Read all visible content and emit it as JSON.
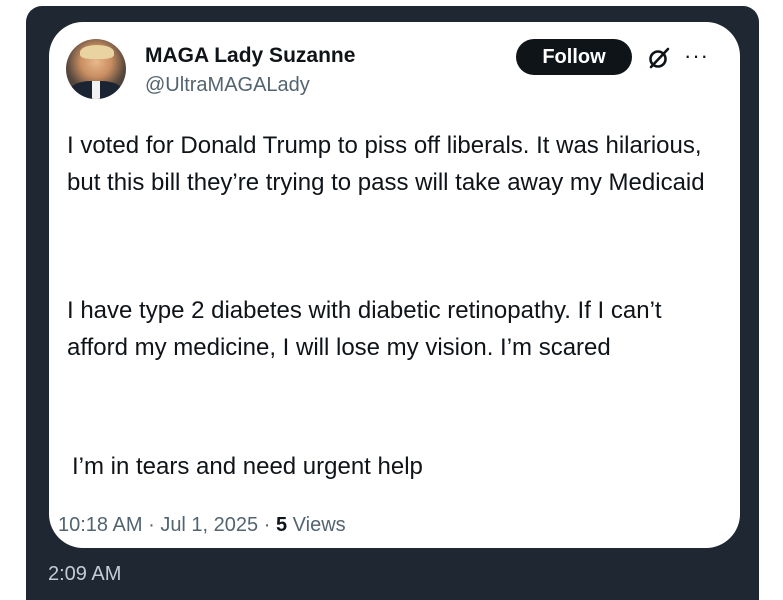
{
  "post": {
    "author_name": "MAGA Lady Suzanne",
    "author_handle": "@UltraMAGALady",
    "follow_label": "Follow",
    "more_label": "···",
    "paragraphs": [
      "I voted for Donald Trump to piss off liberals. It was hilarious, but this bill they’re trying to pass will take away my Medicaid",
      "I have type 2 diabetes with diabetic retinopathy. If I can’t afford my medicine, I will lose my vision. I’m scared",
      "I’m in tears and need urgent help"
    ],
    "time": "10:18 AM",
    "date": "Jul 1, 2025",
    "views_count": "5",
    "views_label": "Views",
    "separator": "·"
  },
  "message": {
    "timestamp": "2:09 AM"
  },
  "colors": {
    "panel": "#1e2732",
    "card": "#ffffff",
    "text": "#0f1419",
    "muted": "#536471",
    "timestamp": "#c4cdd6"
  },
  "icons": {
    "grok": "grok-icon",
    "more": "more-icon"
  }
}
